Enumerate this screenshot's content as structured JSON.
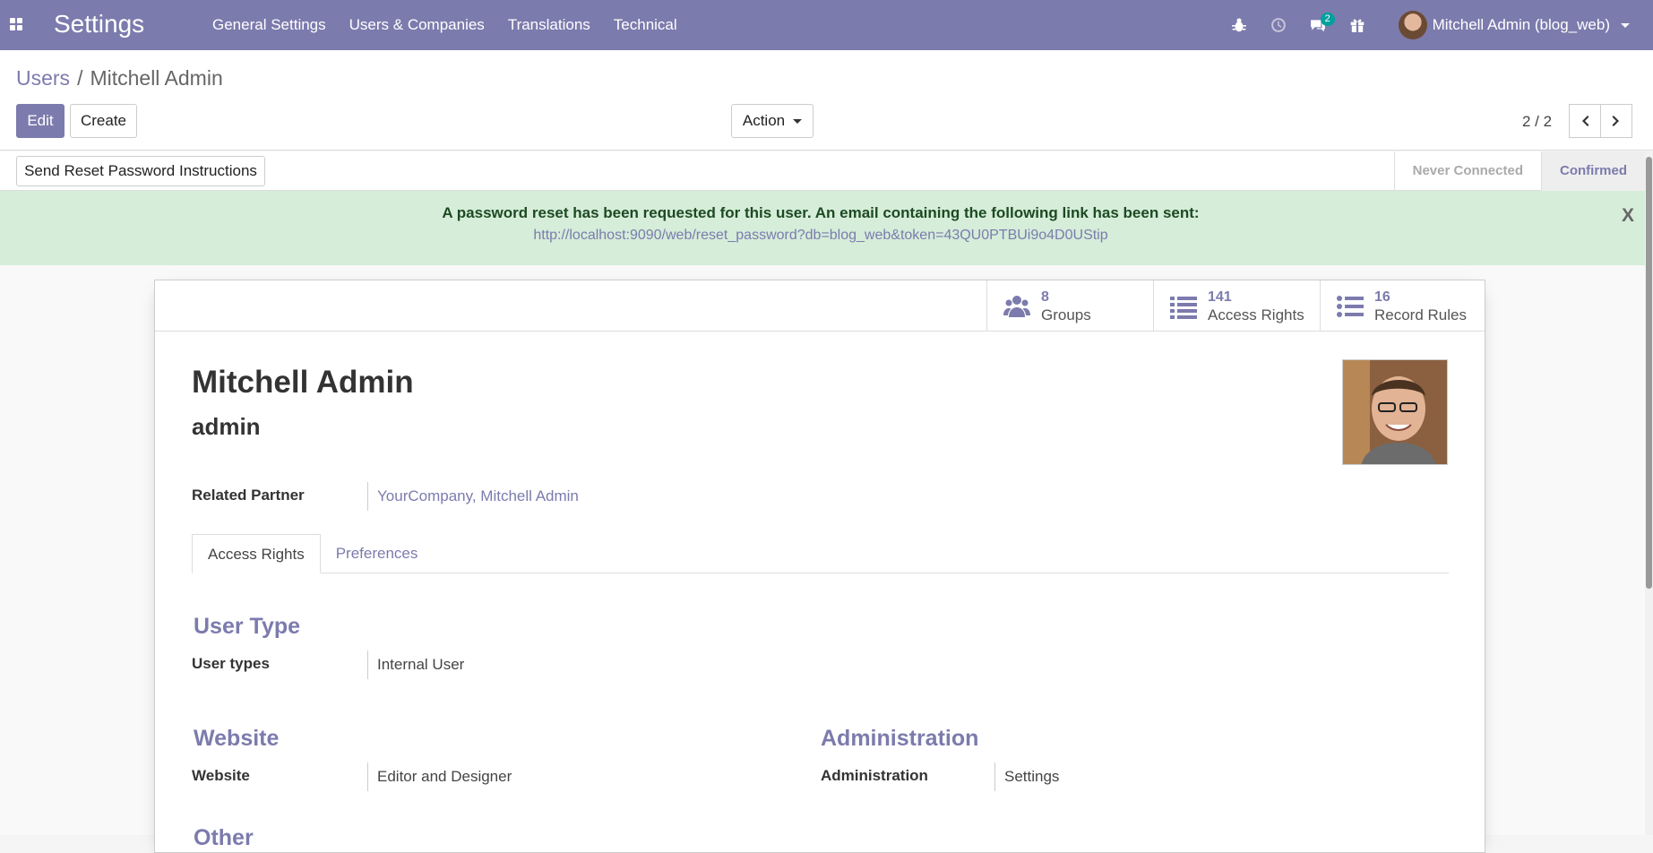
{
  "navbar": {
    "app_title": "Settings",
    "menu": [
      "General Settings",
      "Users & Companies",
      "Translations",
      "Technical"
    ],
    "message_count": "2",
    "user_name": "Mitchell Admin (blog_web)"
  },
  "breadcrumb": {
    "parent": "Users",
    "separator": "/",
    "current": "Mitchell Admin"
  },
  "buttons": {
    "edit": "Edit",
    "create": "Create",
    "action": "Action"
  },
  "pager": {
    "value": "2 / 2"
  },
  "statusbar": {
    "reset_button": "Send Reset Password Instructions",
    "steps": [
      "Never Connected",
      "Confirmed"
    ]
  },
  "alert": {
    "message": "A password reset has been requested for this user. An email containing the following link has been sent:",
    "link": "http://localhost:9090/web/reset_password?db=blog_web&token=43QU0PTBUi9o4D0UStip",
    "close": "X"
  },
  "stats": [
    {
      "value": "8",
      "label": "Groups"
    },
    {
      "value": "141",
      "label": "Access Rights"
    },
    {
      "value": "16",
      "label": "Record Rules"
    }
  ],
  "user": {
    "name": "Mitchell Admin",
    "login": "admin"
  },
  "fields": {
    "related_partner_label": "Related Partner",
    "related_partner_value": "YourCompany, Mitchell Admin"
  },
  "tabs": [
    "Access Rights",
    "Preferences"
  ],
  "sections": {
    "user_type": {
      "title": "User Type",
      "label": "User types",
      "value": "Internal User"
    },
    "website": {
      "title": "Website",
      "label": "Website",
      "value": "Editor and Designer"
    },
    "administration": {
      "title": "Administration",
      "label": "Administration",
      "value": "Settings"
    },
    "other": {
      "title": "Other"
    }
  },
  "colors": {
    "brand": "#7c7bad",
    "alert_bg": "#d5edd9",
    "accent_badge": "#00a09d"
  }
}
